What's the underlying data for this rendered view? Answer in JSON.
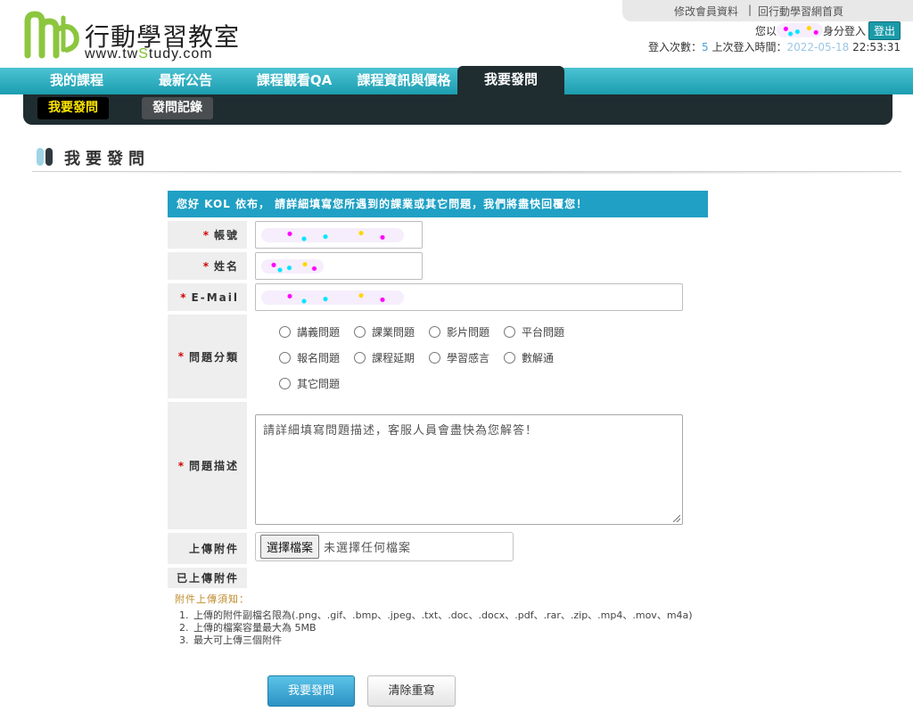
{
  "brand": {
    "logo_text": "行動學習教室",
    "url_prefix": "www.tw",
    "url_s": "S",
    "url_suffix": "tudy.com"
  },
  "toplinks": {
    "edit_profile": "修改會員資料",
    "separator": "|",
    "home": "回行動學習網首頁"
  },
  "user": {
    "prefix": "您以",
    "suffix": "身分登入",
    "logout": "登出",
    "login_count_label": "登入次數：",
    "login_count": "5",
    "last_login_label": " 上次登入時間：",
    "last_login_date": "2022-05-18",
    "last_login_time": "22:53:31"
  },
  "nav": [
    {
      "label": "我的課程"
    },
    {
      "label": "最新公告"
    },
    {
      "label": "課程觀看QA"
    },
    {
      "label": "課程資訊與價格"
    },
    {
      "label": "我要發問"
    }
  ],
  "subnav": [
    {
      "label": "我要發問"
    },
    {
      "label": "發問記錄"
    }
  ],
  "section": {
    "title": "我要發問"
  },
  "form": {
    "banner": "您好 KOL 依布， 請詳細填寫您所遇到的課業或其它問題，我們將盡快回覆您！",
    "required_mark": "*",
    "account_label": "帳號",
    "name_label": "姓名",
    "email_label": "E-Mail",
    "category_label": "問題分類",
    "categories": [
      "講義問題",
      "課業問題",
      "影片問題",
      "平台問題",
      "報名問題",
      "課程延期",
      "學習感言",
      "數解通",
      "其它問題"
    ],
    "description_label": "問題描述",
    "description_placeholder": "請詳細填寫問題描述，客服人員會盡快為您解答！",
    "upload_label": "上傳附件",
    "file_button": "選擇檔案",
    "file_none": "未選擇任何檔案",
    "uploaded_label": "已上傳附件",
    "notes_title": "附件上傳須知：",
    "notes": [
      {
        "num": "1.",
        "text": "上傳的附件副檔名限為(.png、.gif、.bmp、.jpeg、.txt、.doc、.docx、.pdf、.rar、.zip、.mp4、.mov、m4a)"
      },
      {
        "num": "2.",
        "text": "上傳的檔案容量最大為 5MB"
      },
      {
        "num": "3.",
        "text": "最大可上傳三個附件"
      }
    ],
    "submit": "我要發問",
    "reset": "清除重寫"
  },
  "colors": {
    "nav_gradient_top": "#4cc3d3",
    "nav_gradient_bottom": "#1b9db0",
    "dark_bar": "#1f2d31",
    "active_sub_text": "#ffe600",
    "banner": "#1fa0c4",
    "required": "#d40000",
    "logo_green": "#8cc63f"
  }
}
